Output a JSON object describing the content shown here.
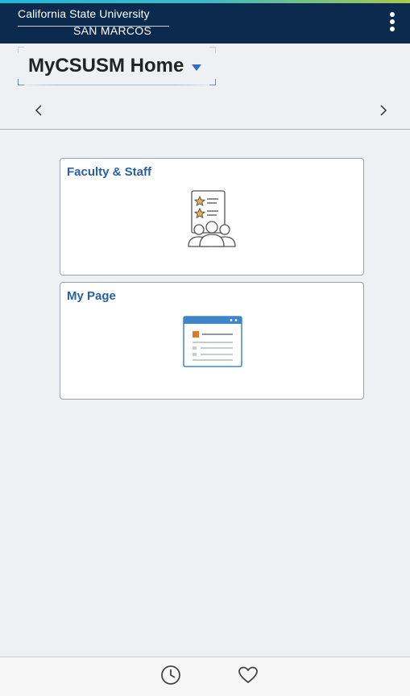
{
  "topbar": {
    "logo_line1": "California State University",
    "logo_line2": "SAN MARCOS",
    "menu_icon": "kebab-vertical-icon",
    "accent_color": "#0b2a4e"
  },
  "header": {
    "home_title": "MyCSUSM Home",
    "dropdown_icon": "caret-down-icon",
    "prev_icon": "chevron-left-icon",
    "next_icon": "chevron-right-icon"
  },
  "tiles": [
    {
      "title": "Faculty & Staff",
      "icon": "faculty-staff-icon"
    },
    {
      "title": "My Page",
      "icon": "my-page-icon"
    }
  ],
  "bottom_nav": {
    "recent_icon": "clock-icon",
    "favorites_icon": "heart-icon"
  },
  "colors": {
    "link_blue": "#2a5fa3",
    "background": "#eef0f4",
    "tile_orange": "#e07b22"
  }
}
